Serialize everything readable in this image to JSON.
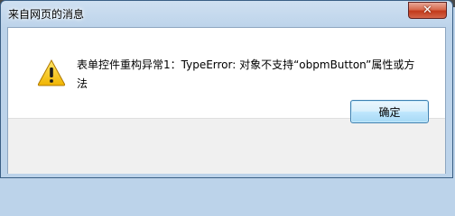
{
  "window": {
    "title": "来自网页的消息"
  },
  "dialog": {
    "message": "表单控件重构异常1：TypeError: 对象不支持“obpmButton”属性或方法",
    "icon": "warning-icon",
    "ok_label": "确定"
  },
  "colors": {
    "frame": "#bcd3ea",
    "close_button": "#c2391b",
    "content_bg": "#ffffff",
    "button_bar_bg": "#f0f0f0",
    "ok_button_border": "#3c7fb1",
    "warning_yellow": "#f5c400"
  }
}
